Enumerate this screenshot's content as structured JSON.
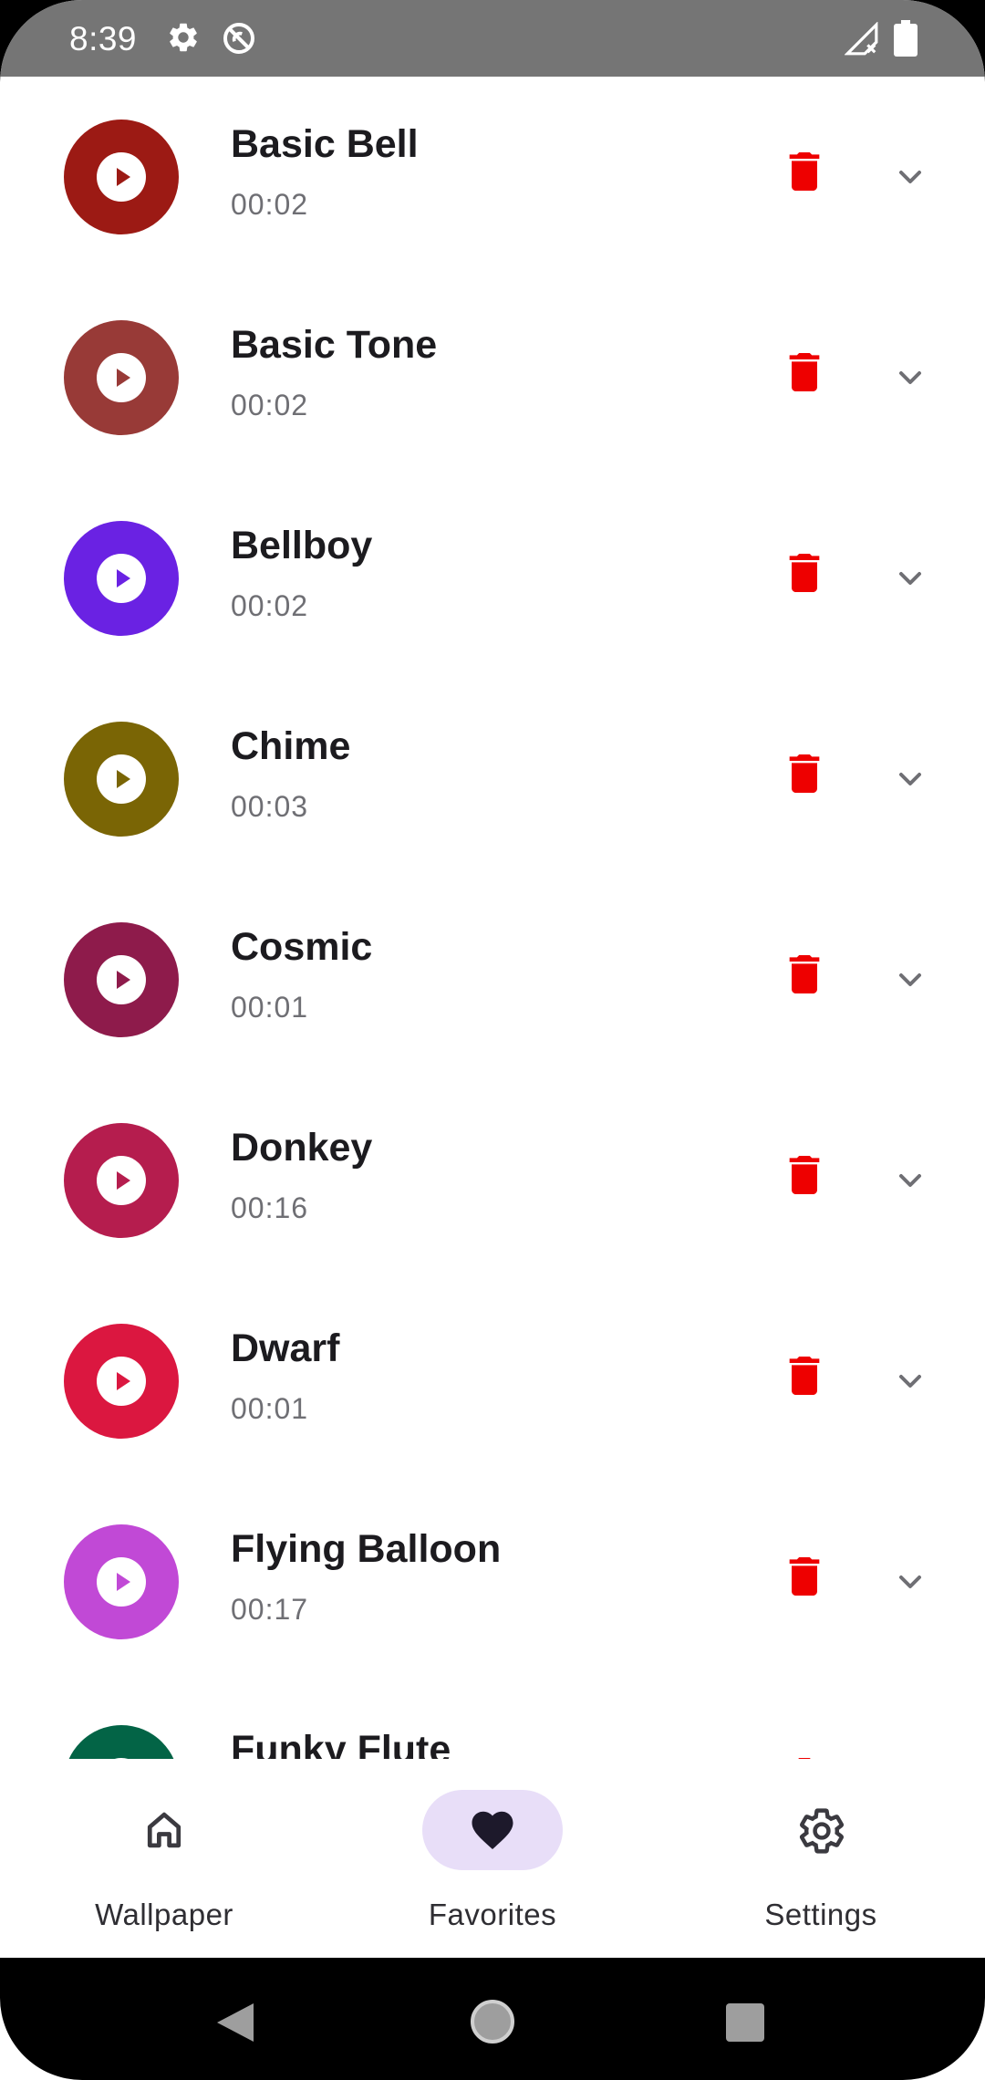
{
  "status_bar": {
    "time": "8:39",
    "icons": [
      "gear-icon",
      "do-not-disturb-icon",
      "signal-x-icon",
      "battery-icon"
    ]
  },
  "ringtones": [
    {
      "title": "Basic Bell",
      "duration": "00:02",
      "color": "#9c1a14"
    },
    {
      "title": "Basic Tone",
      "duration": "00:02",
      "color": "#983a37"
    },
    {
      "title": "Bellboy",
      "duration": "00:02",
      "color": "#6a22e3"
    },
    {
      "title": "Chime",
      "duration": "00:03",
      "color": "#7a6505"
    },
    {
      "title": "Cosmic",
      "duration": "00:01",
      "color": "#8e1b4b"
    },
    {
      "title": "Donkey",
      "duration": "00:16",
      "color": "#b51d4e"
    },
    {
      "title": "Dwarf",
      "duration": "00:01",
      "color": "#db1740"
    },
    {
      "title": "Flying Balloon",
      "duration": "00:17",
      "color": "#c149d6"
    },
    {
      "title": "Funky Flute",
      "duration": "",
      "color": "#036446"
    }
  ],
  "colors": {
    "delete": "#ee0000",
    "chevron": "#6f6f74",
    "nav_active_pill": "#e8def8"
  },
  "bottom_nav": {
    "items": [
      {
        "label": "Wallpaper",
        "icon": "home-icon",
        "active": false
      },
      {
        "label": "Favorites",
        "icon": "heart-icon",
        "active": true
      },
      {
        "label": "Settings",
        "icon": "gear-icon",
        "active": false
      }
    ]
  },
  "system_nav": [
    "back-icon",
    "home-circle-icon",
    "recents-icon"
  ]
}
